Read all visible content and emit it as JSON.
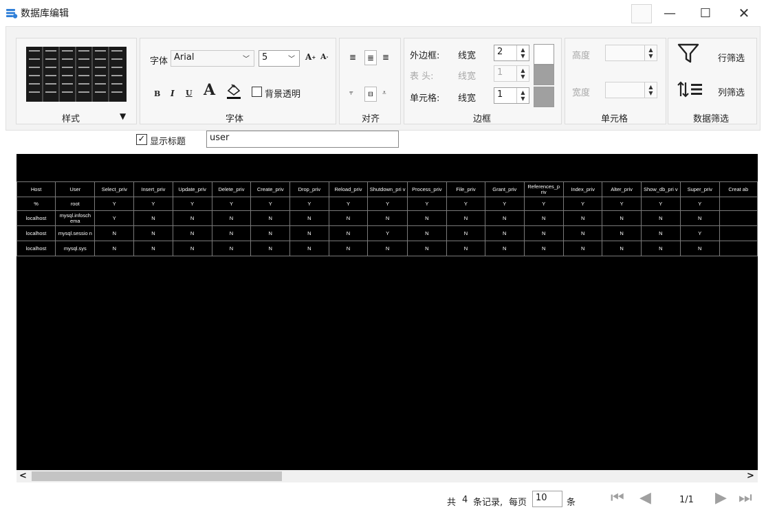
{
  "window": {
    "title": "数据库编辑"
  },
  "ribbon": {
    "style_group": {
      "label": "样式"
    },
    "font_group": {
      "label": "字体",
      "font_label": "字体",
      "font_name": "Arial",
      "font_size": "5",
      "bold": "B",
      "italic": "I",
      "underline": "U",
      "font_color_glyph": "A",
      "transparent_bg_label": "背景透明"
    },
    "align_group": {
      "label": "对齐"
    },
    "border_group": {
      "label": "边框",
      "outer_label": "外边框:",
      "outer_width_label": "线宽",
      "outer_width": "2",
      "header_label": "表 头:",
      "header_width_label": "线宽",
      "header_width": "1",
      "cell_label": "单元格:",
      "cell_width_label": "线宽",
      "cell_width": "1"
    },
    "cell_group": {
      "label": "单元格",
      "height_label": "高度",
      "width_label": "宽度"
    },
    "filter_group": {
      "label": "数据筛选",
      "row_filter": "行筛选",
      "col_filter": "列筛选"
    }
  },
  "title_options": {
    "show_title_label": "显示标题",
    "show_title_checked": true,
    "title_value": "user"
  },
  "table": {
    "columns": [
      "Host",
      "User",
      "Select_priv",
      "Insert_priv",
      "Update_priv",
      "Delete_priv",
      "Create_priv",
      "Drop_priv",
      "Reload_priv",
      "Shutdown_pri v",
      "Process_priv",
      "File_priv",
      "Grant_priv",
      "References_p riv",
      "Index_priv",
      "Alter_priv",
      "Show_db_pri v",
      "Super_priv",
      "Creat ab"
    ],
    "rows": [
      [
        "%",
        "root",
        "Y",
        "Y",
        "Y",
        "Y",
        "Y",
        "Y",
        "Y",
        "Y",
        "Y",
        "Y",
        "Y",
        "Y",
        "Y",
        "Y",
        "Y",
        "Y",
        ""
      ],
      [
        "localhost",
        "mysql.infosch ema",
        "Y",
        "N",
        "N",
        "N",
        "N",
        "N",
        "N",
        "N",
        "N",
        "N",
        "N",
        "N",
        "N",
        "N",
        "N",
        "N",
        ""
      ],
      [
        "localhost",
        "mysql.sessio n",
        "N",
        "N",
        "N",
        "N",
        "N",
        "N",
        "N",
        "Y",
        "N",
        "N",
        "N",
        "N",
        "N",
        "N",
        "N",
        "Y",
        ""
      ],
      [
        "localhost",
        "mysql.sys",
        "N",
        "N",
        "N",
        "N",
        "N",
        "N",
        "N",
        "N",
        "N",
        "N",
        "N",
        "N",
        "N",
        "N",
        "N",
        "N",
        ""
      ]
    ]
  },
  "pagination": {
    "total_prefix": "共",
    "total": "4",
    "total_suffix": "条记录,",
    "per_page_label": "每页",
    "per_page": "10",
    "per_page_unit": "条",
    "page_indicator": "1/1"
  }
}
